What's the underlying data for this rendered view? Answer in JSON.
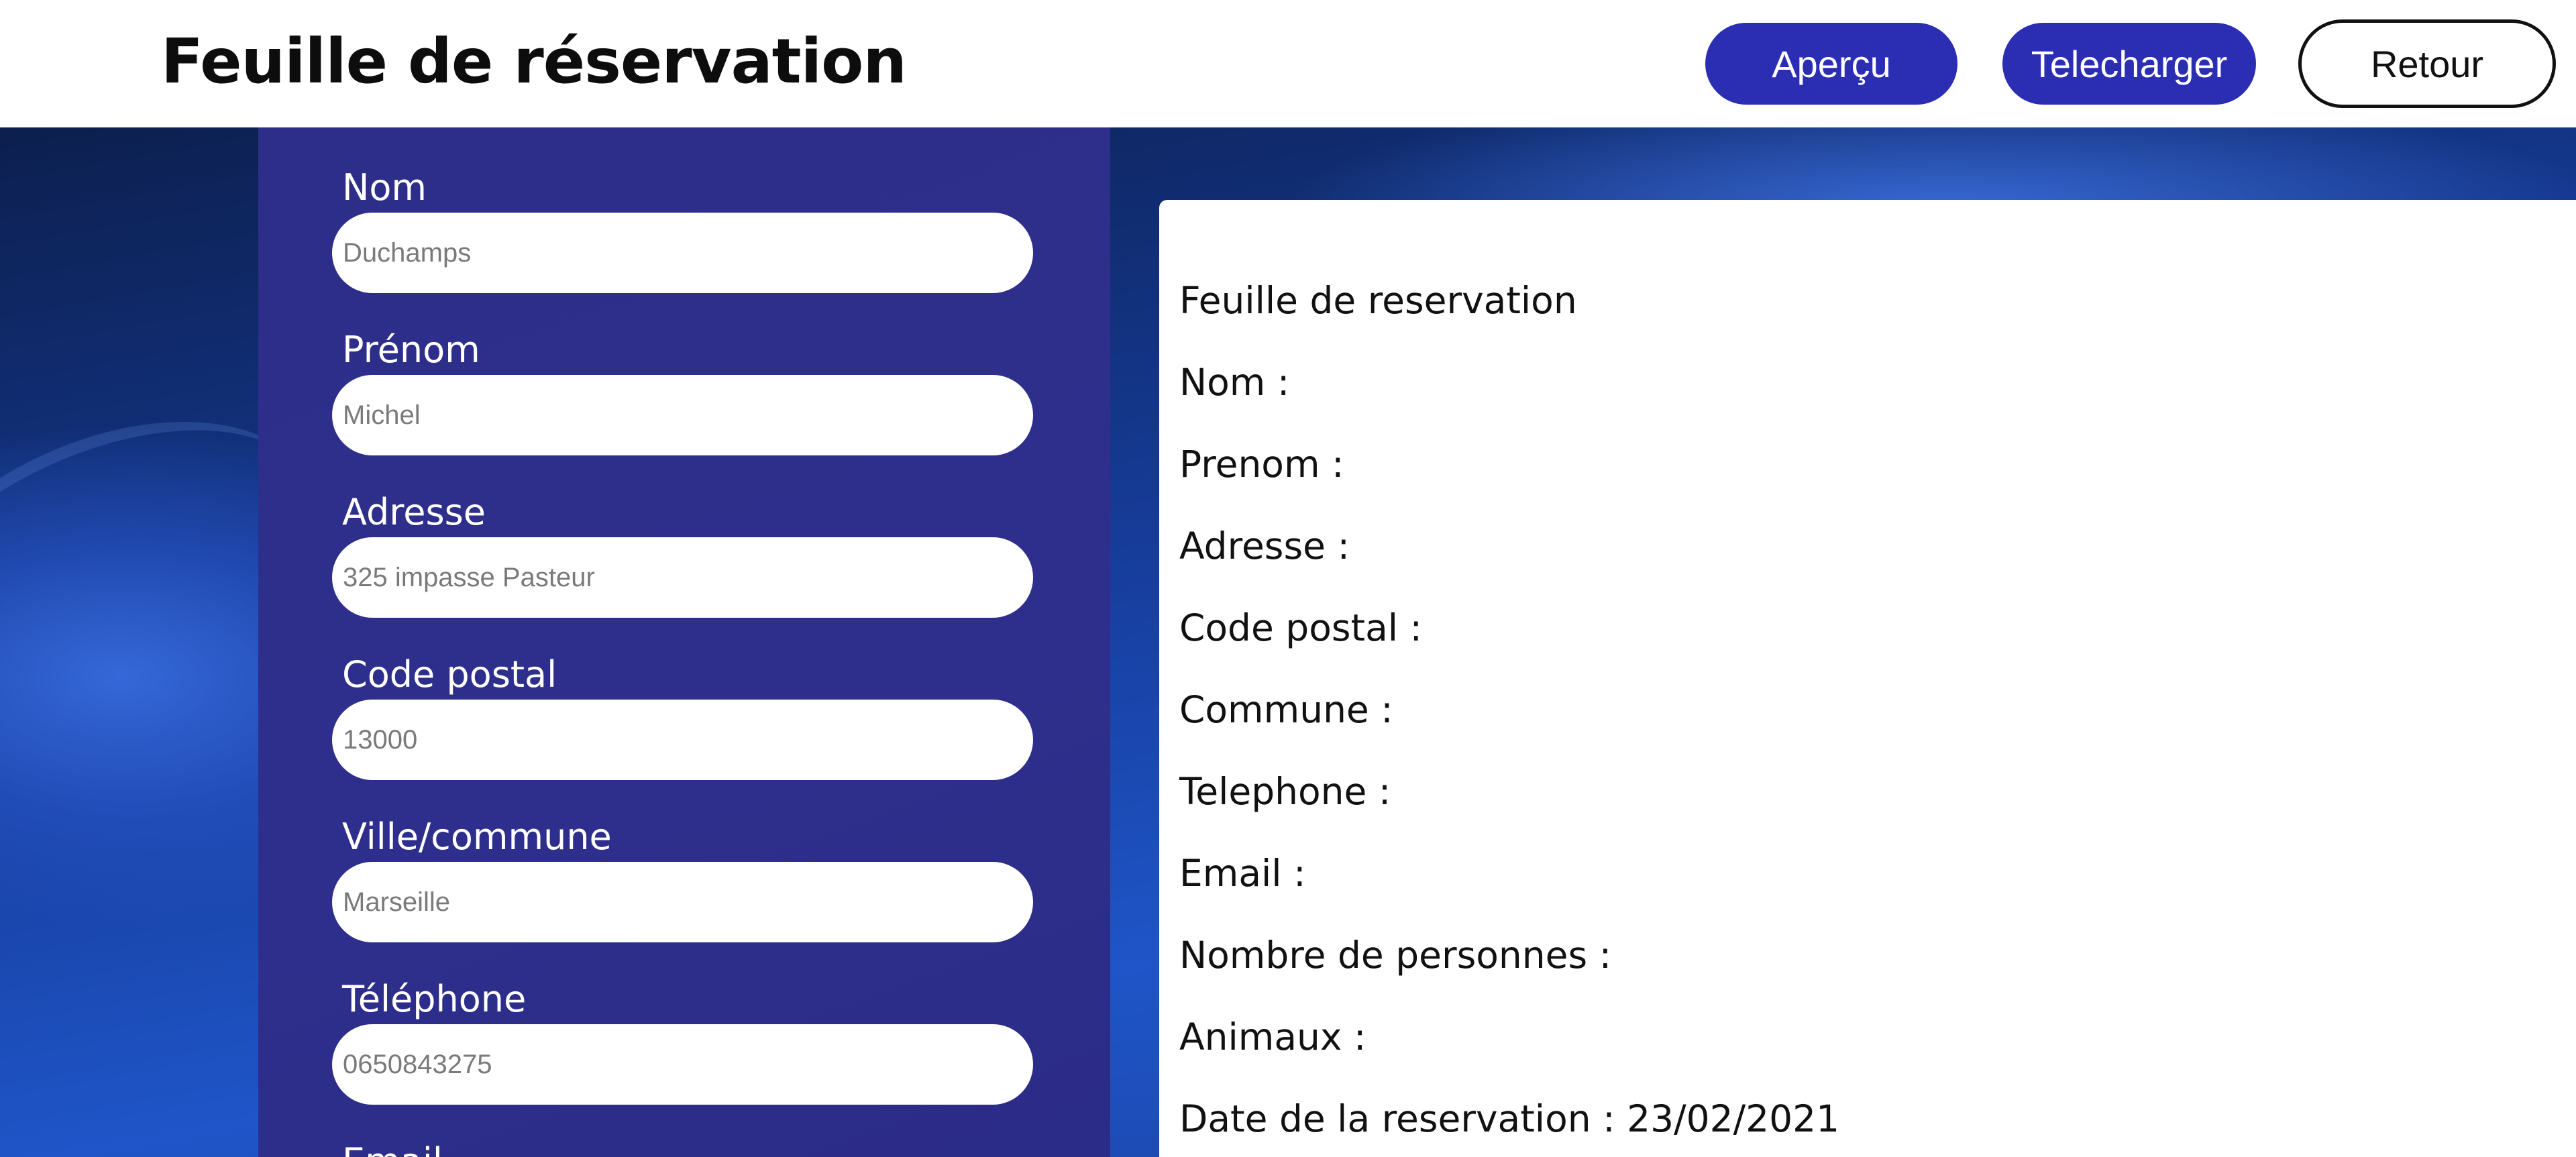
{
  "header": {
    "title": "Feuille de réservation",
    "buttons": {
      "preview": "Aperçu",
      "download": "Telecharger",
      "back": "Retour"
    }
  },
  "form": {
    "fields": [
      {
        "label": "Nom",
        "placeholder": "Duchamps"
      },
      {
        "label": "Prénom",
        "placeholder": "Michel"
      },
      {
        "label": "Adresse",
        "placeholder": "325 impasse Pasteur"
      },
      {
        "label": "Code postal",
        "placeholder": "13000"
      },
      {
        "label": "Ville/commune",
        "placeholder": "Marseille"
      },
      {
        "label": "Téléphone",
        "placeholder": "0650843275"
      },
      {
        "label": "Email"
      }
    ]
  },
  "preview": {
    "title": "Feuille de reservation",
    "lines": [
      "Nom :",
      "Prenom :",
      "Adresse :",
      "Code postal :",
      "Commune :",
      "Telephone :",
      "Email :",
      "Nombre de personnes :",
      "Animaux :",
      "Date de la reservation : 23/02/2021"
    ]
  },
  "colors": {
    "primary_button": "#2b2db3",
    "form_panel": "#2d2e8a",
    "background_blue": "#1f55c8"
  }
}
